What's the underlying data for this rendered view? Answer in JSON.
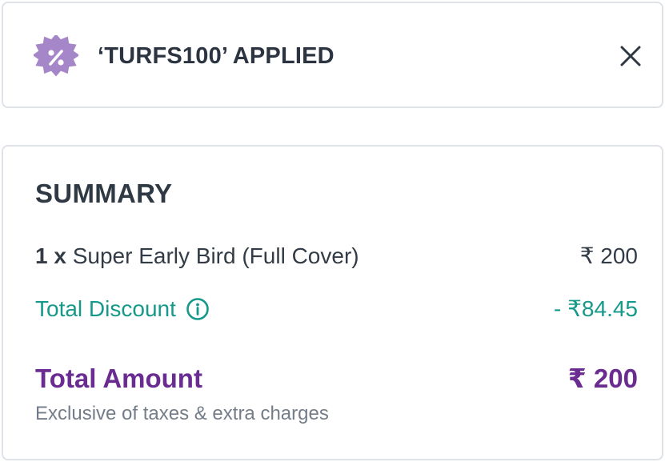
{
  "coupon": {
    "icon": "discount-badge-icon",
    "text": "‘TURFS100’ APPLIED",
    "close_icon": "close-icon",
    "badge_color": "#a586c8"
  },
  "summary": {
    "title": "SUMMARY",
    "item": {
      "qty": "1 x",
      "name": "Super Early Bird (Full Cover)",
      "price": "₹ 200"
    },
    "discount": {
      "label": "Total Discount",
      "info_icon": "info-icon",
      "value": "- ₹84.45",
      "color": "#16998a"
    },
    "total": {
      "label": "Total Amount",
      "value": "₹ 200",
      "color": "#6a2c91"
    },
    "note": "Exclusive of taxes & extra charges"
  }
}
